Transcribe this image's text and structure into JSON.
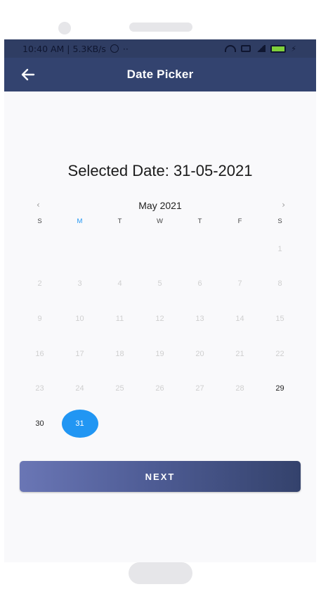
{
  "status_bar": {
    "time_and_speed": "10:40 AM | 5.3KB/s",
    "notification_dots": "··",
    "battery_level": "100"
  },
  "app_bar": {
    "title": "Date Picker",
    "back_icon": "arrow-left-icon"
  },
  "selected_date_text": "Selected Date: 31-05-2021",
  "calendar": {
    "month_label": "May 2021",
    "prev_icon": "‹",
    "next_icon": "›",
    "weekdays": [
      "S",
      "M",
      "T",
      "W",
      "T",
      "F",
      "S"
    ],
    "today_weekday_index": 1,
    "days": [
      "",
      "",
      "",
      "",
      "",
      "",
      "1",
      "2",
      "3",
      "4",
      "5",
      "6",
      "7",
      "8",
      "9",
      "10",
      "11",
      "12",
      "13",
      "14",
      "15",
      "16",
      "17",
      "18",
      "19",
      "20",
      "21",
      "22",
      "23",
      "24",
      "25",
      "26",
      "27",
      "28",
      "29",
      "30",
      "31"
    ],
    "enabled_days": [
      "29",
      "30",
      "31"
    ],
    "selected_day": "31",
    "accent_color": "#2196f3"
  },
  "next_button": {
    "label": "NEXT"
  },
  "colors": {
    "app_bar": "#33436f",
    "button_gradient_start": "#6a76b5",
    "button_gradient_end": "#34426c"
  }
}
